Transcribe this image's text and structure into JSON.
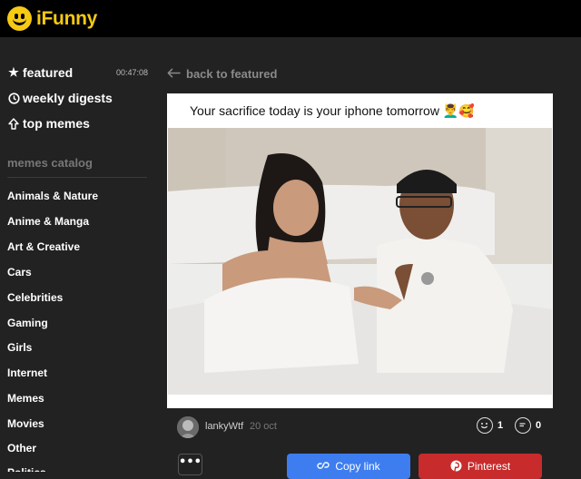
{
  "header": {
    "logo_text": "iFunny"
  },
  "sidebar": {
    "nav": [
      {
        "label": "featured",
        "icon": "star-icon"
      },
      {
        "label": "weekly digests",
        "icon": "clock-icon"
      },
      {
        "label": "top memes",
        "icon": "up-arrow-icon"
      }
    ],
    "timer": "00:47:08",
    "catalog_title": "memes catalog",
    "categories": [
      "Animals & Nature",
      "Anime & Manga",
      "Art & Creative",
      "Cars",
      "Celebrities",
      "Gaming",
      "Girls",
      "Internet",
      "Memes",
      "Movies",
      "Other",
      "Politics"
    ]
  },
  "main": {
    "back_label": "back to featured",
    "post": {
      "caption": "Your sacrifice today is your iphone tomorrow 💆‍♂️🥰",
      "author": "lankyWtf",
      "date": "20 oct",
      "smiles": "1",
      "comments": "0"
    },
    "actions": {
      "more": "•••",
      "copy_link": "Copy link",
      "pinterest": "Pinterest"
    }
  },
  "colors": {
    "brand": "#f6c913",
    "copy": "#3d7df0",
    "pinterest": "#c82b2b"
  }
}
